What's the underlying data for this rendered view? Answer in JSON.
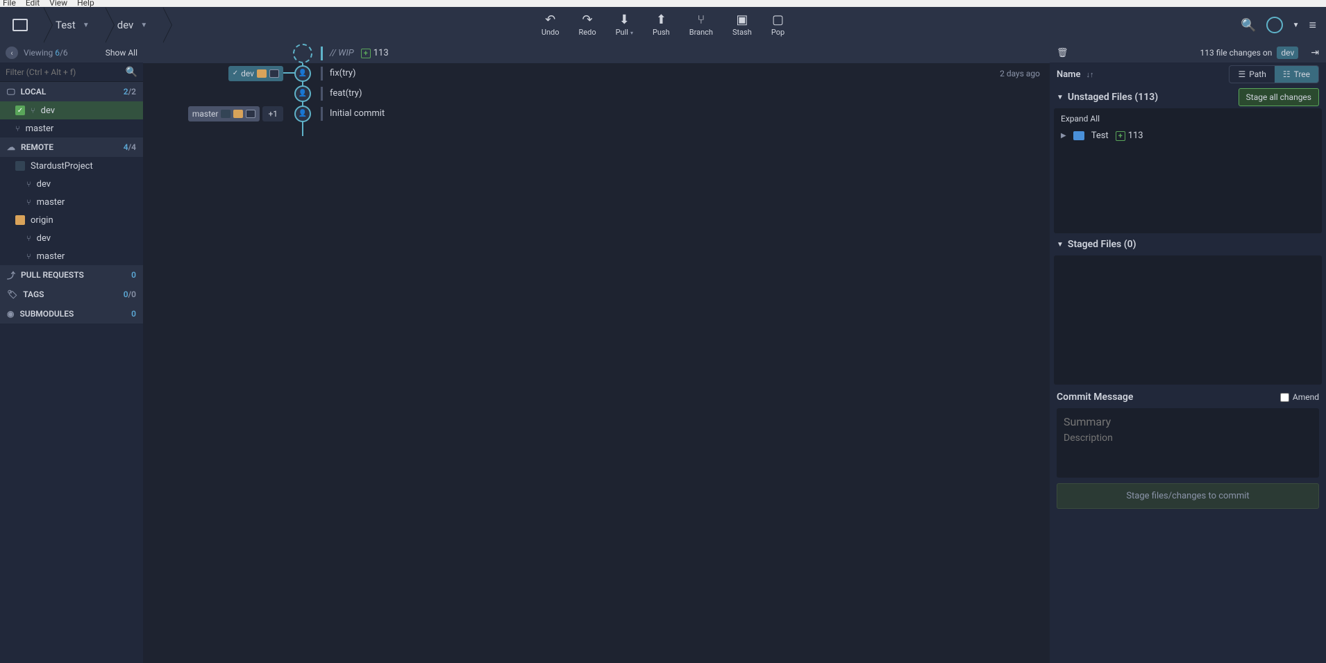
{
  "menubar": {
    "file": "File",
    "edit": "Edit",
    "view": "View",
    "help": "Help"
  },
  "crumbs": {
    "repo": "Test",
    "branch": "dev"
  },
  "toolbar": {
    "undo": "Undo",
    "redo": "Redo",
    "pull": "Pull",
    "push": "Push",
    "branch": "Branch",
    "stash": "Stash",
    "pop": "Pop"
  },
  "sidebar": {
    "viewing_label": "Viewing",
    "viewing_count": "6",
    "viewing_total": "/6",
    "show_all": "Show All",
    "filter_placeholder": "Filter (Ctrl + Alt + f)",
    "sections": {
      "local": {
        "label": "LOCAL",
        "count_a": "2",
        "count_b": "/2",
        "items": [
          {
            "name": "dev",
            "active": true
          },
          {
            "name": "master"
          }
        ]
      },
      "remote": {
        "label": "REMOTE",
        "count_a": "4",
        "count_b": "/4",
        "remotes": [
          {
            "name": "StardustProject",
            "branches": [
              "dev",
              "master"
            ]
          },
          {
            "name": "origin",
            "branches": [
              "dev",
              "master"
            ]
          }
        ]
      },
      "pull_requests": {
        "label": "PULL REQUESTS",
        "count": "0"
      },
      "tags": {
        "label": "TAGS",
        "count_a": "0",
        "count_b": "/0"
      },
      "submodules": {
        "label": "SUBMODULES",
        "count": "0"
      }
    }
  },
  "graph": {
    "wip": {
      "label": "// WIP",
      "file_count": "113"
    },
    "commits": [
      {
        "refs": [
          {
            "text": "dev",
            "checked": true,
            "icons": 2
          }
        ],
        "message": "fix(try)",
        "date": "2 days ago"
      },
      {
        "refs": [],
        "message": "feat(try)",
        "date": ""
      },
      {
        "refs": [
          {
            "text": "master",
            "icons": 3,
            "plus": "+1"
          }
        ],
        "message": "Initial commit",
        "date": ""
      }
    ]
  },
  "right": {
    "header": {
      "count": "113",
      "text": "file changes on",
      "branch": "dev"
    },
    "sort_label": "Name",
    "path": "Path",
    "tree": "Tree",
    "unstaged": {
      "title": "Unstaged Files (113)",
      "stage_all": "Stage all changes",
      "expand_all": "Expand All",
      "folder": "Test",
      "folder_count": "113"
    },
    "staged": {
      "title": "Staged Files (0)"
    },
    "commit": {
      "title": "Commit Message",
      "amend": "Amend",
      "summary_ph": "Summary",
      "desc_ph": "Description",
      "button": "Stage files/changes to commit"
    }
  }
}
